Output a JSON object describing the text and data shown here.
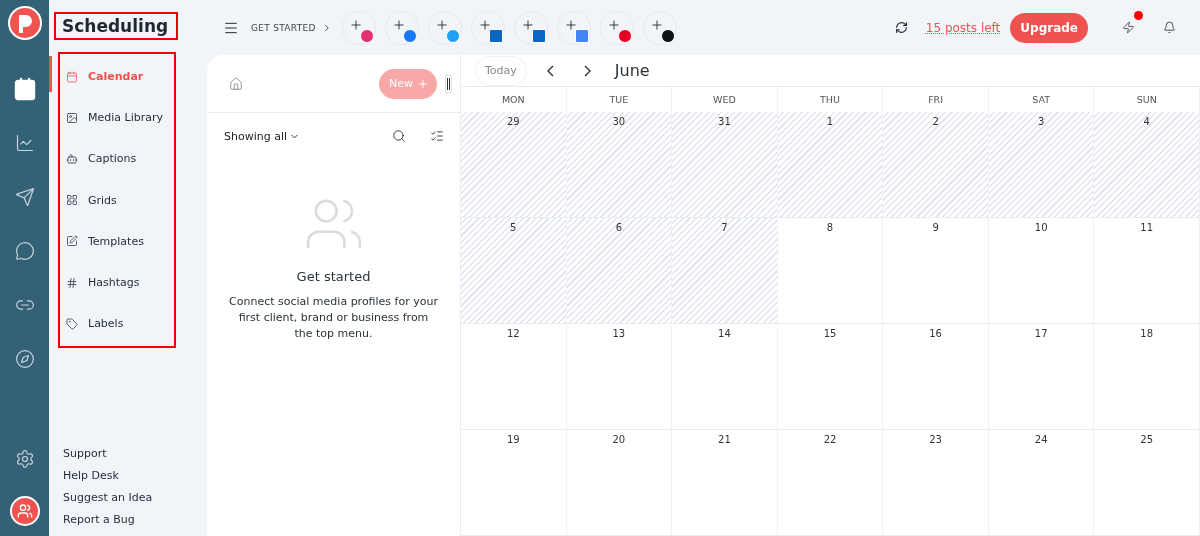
{
  "app": {
    "section_title": "Scheduling"
  },
  "nav": [
    {
      "label": "Calendar",
      "selected": true
    },
    {
      "label": "Media Library",
      "selected": false
    },
    {
      "label": "Captions",
      "selected": false
    },
    {
      "label": "Grids",
      "selected": false
    },
    {
      "label": "Templates",
      "selected": false
    },
    {
      "label": "Hashtags",
      "selected": false
    },
    {
      "label": "Labels",
      "selected": false
    }
  ],
  "footer_links": [
    "Support",
    "Help Desk",
    "Suggest an Idea",
    "Report a Bug"
  ],
  "rail": [
    {
      "selected": true
    },
    {
      "selected": false
    },
    {
      "selected": false
    },
    {
      "selected": false
    },
    {
      "selected": false
    },
    {
      "selected": false
    }
  ],
  "topbar": {
    "get_started": "GET STARTED",
    "profiles": [
      {
        "kind": "instagram"
      },
      {
        "kind": "facebook"
      },
      {
        "kind": "twitter"
      },
      {
        "kind": "linkedin"
      },
      {
        "kind": "linkedin"
      },
      {
        "kind": "business"
      },
      {
        "kind": "pinterest"
      },
      {
        "kind": "tiktok"
      }
    ],
    "posts_left": "15 posts left",
    "upgrade": "Upgrade",
    "notification_dot": true
  },
  "toolbar": {
    "new_button": "New",
    "today_button": "Today",
    "month": "June"
  },
  "panel": {
    "filter": "Showing all",
    "empty_title": "Get started",
    "empty_text": "Connect social media profiles for your first client, brand or business from the top menu."
  },
  "calendar": {
    "weekdays": [
      "MON",
      "TUE",
      "WED",
      "THU",
      "FRI",
      "SAT",
      "SUN"
    ],
    "weeks": [
      [
        {
          "day": "29",
          "past": true
        },
        {
          "day": "30",
          "past": true
        },
        {
          "day": "31",
          "past": true
        },
        {
          "day": "1",
          "past": true
        },
        {
          "day": "2",
          "past": true
        },
        {
          "day": "3",
          "past": true
        },
        {
          "day": "4",
          "past": true
        }
      ],
      [
        {
          "day": "5",
          "past": true
        },
        {
          "day": "6",
          "past": true
        },
        {
          "day": "7",
          "past": true
        },
        {
          "day": "8",
          "past": false
        },
        {
          "day": "9",
          "past": false
        },
        {
          "day": "10",
          "past": false
        },
        {
          "day": "11",
          "past": false
        }
      ],
      [
        {
          "day": "12",
          "past": false
        },
        {
          "day": "13",
          "past": false
        },
        {
          "day": "14",
          "past": false
        },
        {
          "day": "15",
          "past": false
        },
        {
          "day": "16",
          "past": false
        },
        {
          "day": "17",
          "past": false
        },
        {
          "day": "18",
          "past": false
        }
      ],
      [
        {
          "day": "19",
          "past": false
        },
        {
          "day": "20",
          "past": false
        },
        {
          "day": "21",
          "past": false
        },
        {
          "day": "22",
          "past": false
        },
        {
          "day": "23",
          "past": false
        },
        {
          "day": "24",
          "past": false
        },
        {
          "day": "25",
          "past": false
        }
      ]
    ]
  }
}
